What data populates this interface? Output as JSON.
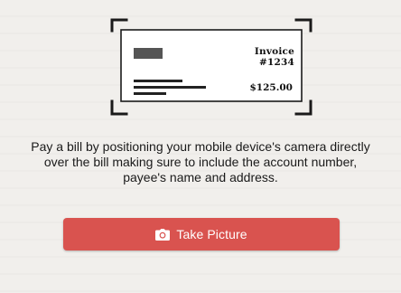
{
  "illustration": {
    "invoice_number": "Invoice #1234",
    "invoice_amount": "$125.00",
    "icon": "bill-scan-frame-icon"
  },
  "instructions": {
    "text": "Pay a bill by positioning your mobile device's camera directly over the bill making sure to include the account number, payee's name and address."
  },
  "take_picture_button": {
    "label": "Take Picture",
    "icon": "camera-icon",
    "color": "#d9534f",
    "text_color": "#ffffff"
  }
}
